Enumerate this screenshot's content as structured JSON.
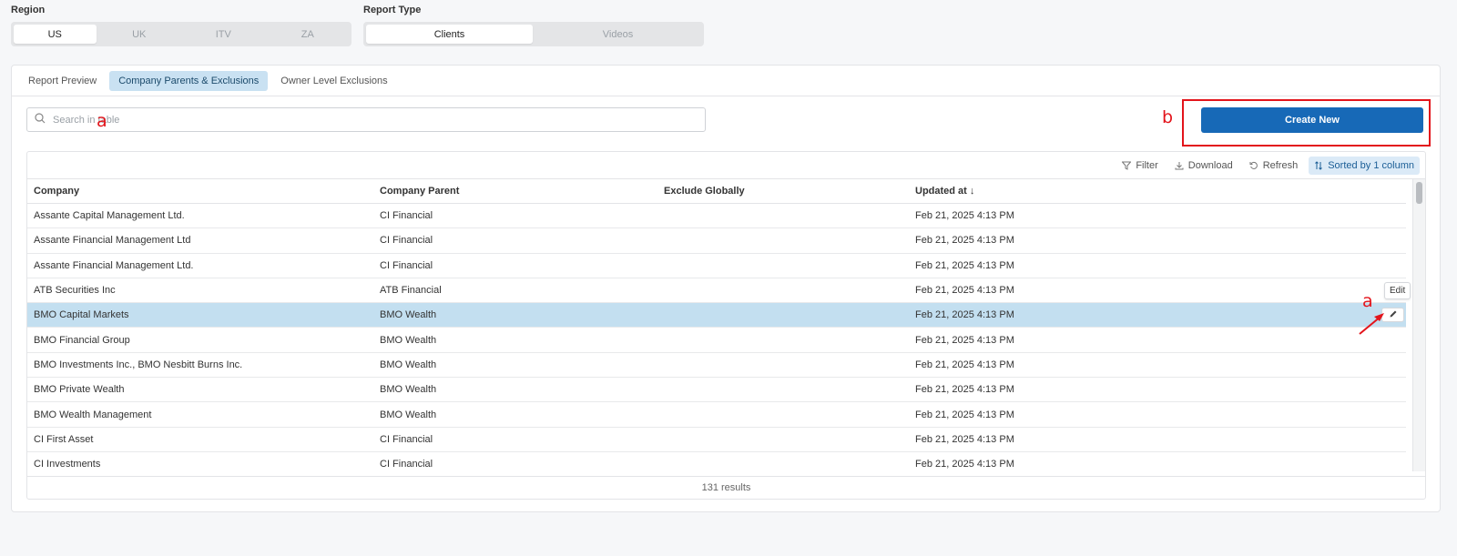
{
  "region": {
    "label": "Region",
    "options": [
      "US",
      "UK",
      "ITV",
      "ZA"
    ],
    "selected": "US"
  },
  "report_type": {
    "label": "Report Type",
    "options": [
      "Clients",
      "Videos"
    ],
    "selected": "Clients"
  },
  "tabs": [
    {
      "label": "Report Preview",
      "active": false
    },
    {
      "label": "Company Parents & Exclusions",
      "active": true
    },
    {
      "label": "Owner Level Exclusions",
      "active": false
    }
  ],
  "search": {
    "placeholder": "Search in table",
    "value": ""
  },
  "create_button": {
    "label": "Create New"
  },
  "toolbar": {
    "filter": "Filter",
    "download": "Download",
    "refresh": "Refresh",
    "sorted": "Sorted by 1 column"
  },
  "table": {
    "columns": [
      "Company",
      "Company Parent",
      "Exclude Globally",
      "Updated at"
    ],
    "sort_indicator": "↓",
    "rows": [
      {
        "company": "Assante Capital Management Ltd.",
        "parent": "CI Financial",
        "exclude": "",
        "updated": "Feb 21, 2025 4:13 PM"
      },
      {
        "company": "Assante Financial Management Ltd",
        "parent": "CI Financial",
        "exclude": "",
        "updated": "Feb 21, 2025 4:13 PM"
      },
      {
        "company": "Assante Financial Management Ltd.",
        "parent": "CI Financial",
        "exclude": "",
        "updated": "Feb 21, 2025 4:13 PM"
      },
      {
        "company": "ATB Securities Inc",
        "parent": "ATB Financial",
        "exclude": "",
        "updated": "Feb 21, 2025 4:13 PM"
      },
      {
        "company": "BMO Capital Markets",
        "parent": "BMO Wealth",
        "exclude": "",
        "updated": "Feb 21, 2025 4:13 PM",
        "selected": true
      },
      {
        "company": "BMO Financial Group",
        "parent": "BMO Wealth",
        "exclude": "",
        "updated": "Feb 21, 2025 4:13 PM"
      },
      {
        "company": "BMO Investments Inc., BMO Nesbitt Burns Inc.",
        "parent": "BMO Wealth",
        "exclude": "",
        "updated": "Feb 21, 2025 4:13 PM"
      },
      {
        "company": "BMO Private Wealth",
        "parent": "BMO Wealth",
        "exclude": "",
        "updated": "Feb 21, 2025 4:13 PM"
      },
      {
        "company": "BMO Wealth Management",
        "parent": "BMO Wealth",
        "exclude": "",
        "updated": "Feb 21, 2025 4:13 PM"
      },
      {
        "company": "CI First Asset",
        "parent": "CI Financial",
        "exclude": "",
        "updated": "Feb 21, 2025 4:13 PM"
      },
      {
        "company": "CI Investments",
        "parent": "CI Financial",
        "exclude": "",
        "updated": "Feb 21, 2025 4:13 PM"
      }
    ],
    "footer": "131 results"
  },
  "tooltip": {
    "label": "Edit"
  },
  "annotations": {
    "a1": "a",
    "a2": "a",
    "b": "b",
    "color": "#e3141b"
  },
  "icons": {
    "search": "search-icon",
    "filter": "filter-icon",
    "download": "download-icon",
    "refresh": "refresh-icon",
    "sort": "sort-icon",
    "edit": "pencil-icon"
  }
}
